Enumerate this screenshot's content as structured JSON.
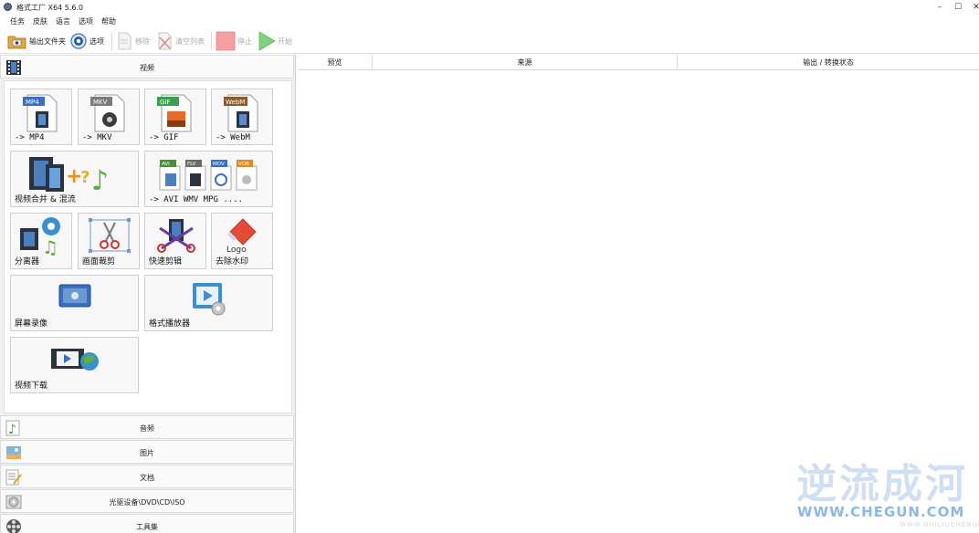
{
  "window": {
    "title": "格式工厂 X64 5.6.0",
    "controls": {
      "minimize": "–",
      "maximize": "☐",
      "close": "✕"
    }
  },
  "menu": [
    "任务",
    "皮肤",
    "语言",
    "选项",
    "帮助"
  ],
  "toolbar": {
    "output_folder": "输出文件夹",
    "options": "选项",
    "remove": "移除",
    "clear_list": "清空列表",
    "stop": "停止",
    "start": "开始"
  },
  "categories": {
    "video": "视频",
    "audio": "音频",
    "image": "图片",
    "document": "文档",
    "disc": "光驱设备\\DVD\\CD\\ISO",
    "tools": "工具集"
  },
  "tiles": {
    "mp4": "-> MP4",
    "mkv": "-> MKV",
    "gif": "-> GIF",
    "webm": "-> WebM",
    "merge": "视频合并 & 混流",
    "other": "-> AVI WMV MPG ....",
    "splitter": "分离器",
    "crop": "画面裁剪",
    "quick_clip": "快速剪辑",
    "remove_logo": "去除水印",
    "screen_record": "屏幕录像",
    "player": "格式播放器",
    "download": "视频下载"
  },
  "icon_badges": {
    "mp4": "MP4",
    "mkv": "MKV",
    "gif": "GIF",
    "webm": "WebM",
    "avi": "AVI",
    "flv": "FLV",
    "mov": "MOV",
    "vob": "VOB",
    "logo": "Logo"
  },
  "table": {
    "columns": [
      "预览",
      "来源",
      "输出 / 转换状态"
    ]
  },
  "watermark": {
    "cn": "逆流成河",
    "url": "WWW.CHEGUN.COM",
    "sub": "WWW.NIULIUCHENGHE.COM"
  },
  "colors": {
    "mp4_badge": "#3a6fc4",
    "mkv_badge": "#7a7a7a",
    "gif_badge": "#3aa050",
    "webm_badge": "#8a5a2a",
    "stop": "#f08a8a",
    "start": "#4caf50",
    "watermark_cn": "#cfe0f3",
    "watermark_url": "#8ab8ec"
  }
}
